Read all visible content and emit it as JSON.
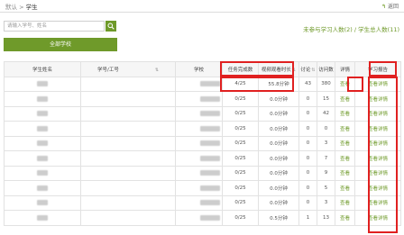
{
  "breadcrumb": {
    "parent": "默认",
    "separator": ">",
    "current": "学生"
  },
  "back": {
    "label": "返回"
  },
  "search": {
    "placeholder": "请输入学号、姓名",
    "value": ""
  },
  "all_school_button": {
    "label": "全部学校"
  },
  "summary": {
    "text": "未参与学习人数(2) / 学生总人数(11)"
  },
  "table": {
    "headers": {
      "name": "学生姓名",
      "id": "学号/工号",
      "school": "学校",
      "tasks": "任务完成数",
      "video": "视频观看时长",
      "discuss": "讨论",
      "visits": "访问数",
      "detail": "详情",
      "report": "学习报告"
    },
    "rows": [
      {
        "tasks": "4/25",
        "video": "55.8分钟",
        "discuss": "43",
        "visits": "380",
        "detail": "查看",
        "report": "查看详情"
      },
      {
        "tasks": "0/25",
        "video": "0.0分钟",
        "discuss": "0",
        "visits": "15",
        "detail": "查看",
        "report": "查看详情"
      },
      {
        "tasks": "0/25",
        "video": "0.0分钟",
        "discuss": "0",
        "visits": "42",
        "detail": "查看",
        "report": "查看详情"
      },
      {
        "tasks": "0/25",
        "video": "0.0分钟",
        "discuss": "0",
        "visits": "0",
        "detail": "查看",
        "report": "查看详情"
      },
      {
        "tasks": "0/25",
        "video": "0.0分钟",
        "discuss": "0",
        "visits": "3",
        "detail": "查看",
        "report": "查看详情"
      },
      {
        "tasks": "0/25",
        "video": "0.0分钟",
        "discuss": "0",
        "visits": "7",
        "detail": "查看",
        "report": "查看详情"
      },
      {
        "tasks": "0/25",
        "video": "0.0分钟",
        "discuss": "0",
        "visits": "9",
        "detail": "查看",
        "report": "查看详情"
      },
      {
        "tasks": "0/25",
        "video": "0.0分钟",
        "discuss": "0",
        "visits": "5",
        "detail": "查看",
        "report": "查看详情"
      },
      {
        "tasks": "0/25",
        "video": "0.0分钟",
        "discuss": "0",
        "visits": "3",
        "detail": "查看",
        "report": "查看详情"
      },
      {
        "tasks": "0/25",
        "video": "0.5分钟",
        "discuss": "1",
        "visits": "13",
        "detail": "查看",
        "report": "查看详情"
      }
    ]
  },
  "colors": {
    "accent": "#6f9a2a",
    "highlight": "#e02020"
  },
  "icons": {
    "search": "search-icon",
    "back": "back-arrow-icon",
    "sort": "sort-icon"
  }
}
